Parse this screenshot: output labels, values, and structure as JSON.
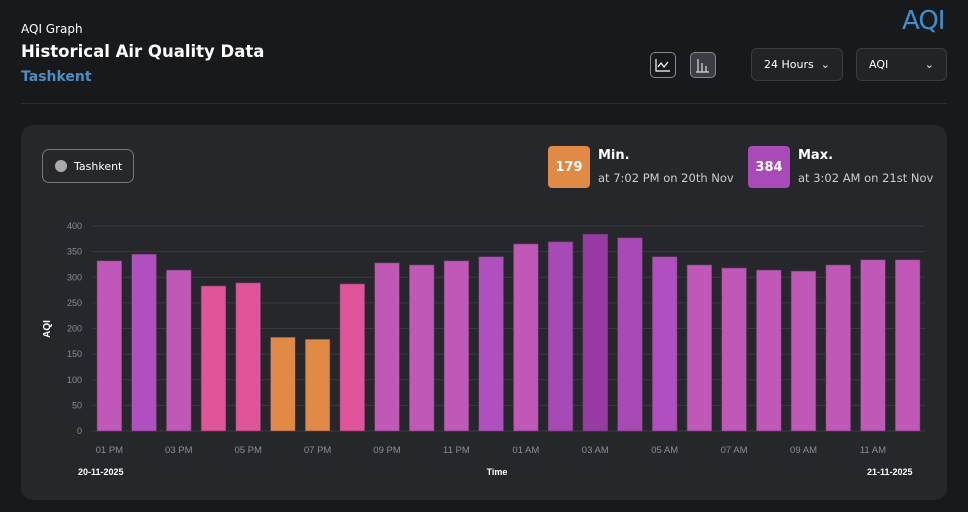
{
  "header": {
    "subtitle": "AQI Graph",
    "title": "Historical Air Quality Data",
    "city": "Tashkent",
    "logo": "AQI"
  },
  "toolbar": {
    "line_chart_icon": "line-chart-icon",
    "bar_chart_icon": "bar-chart-icon",
    "range": "24 Hours",
    "metric": "AQI"
  },
  "legend": {
    "label": "Tashkent"
  },
  "stats": {
    "min": {
      "value": "179",
      "label": "Min.",
      "detail": "at 7:02 PM on 20th Nov",
      "color": "#e08a45"
    },
    "max": {
      "value": "384",
      "label": "Max.",
      "detail": "at 3:02 AM on 21st Nov",
      "color": "#a84ab8"
    }
  },
  "chart_data": {
    "type": "bar",
    "ylabel": "AQI",
    "xlabel": "Time",
    "ylim": [
      0,
      400
    ],
    "yticks": [
      0,
      50,
      100,
      150,
      200,
      250,
      300,
      350,
      400
    ],
    "categories": [
      "01 PM",
      "02 PM",
      "03 PM",
      "04 PM",
      "05 PM",
      "06 PM",
      "07 PM",
      "08 PM",
      "09 PM",
      "10 PM",
      "11 PM",
      "12 AM",
      "01 AM",
      "02 AM",
      "03 AM",
      "04 AM",
      "05 AM",
      "06 AM",
      "07 AM",
      "08 AM",
      "09 AM",
      "10 AM",
      "11 AM",
      "12 PM"
    ],
    "xtick_labels": [
      "01 PM",
      "03 PM",
      "05 PM",
      "07 PM",
      "09 PM",
      "11 PM",
      "01 AM",
      "03 AM",
      "05 AM",
      "07 AM",
      "09 AM",
      "11 AM"
    ],
    "values": [
      332,
      345,
      314,
      283,
      289,
      183,
      179,
      287,
      328,
      324,
      332,
      340,
      365,
      369,
      384,
      377,
      340,
      324,
      318,
      314,
      312,
      324,
      334,
      334
    ],
    "colors": [
      "#c058b8",
      "#b050c0",
      "#c058b8",
      "#e0559a",
      "#e0559a",
      "#e08a45",
      "#e08a45",
      "#e0559a",
      "#c058b8",
      "#c058b8",
      "#c058b8",
      "#b050c0",
      "#c058b8",
      "#a84ab5",
      "#983aa3",
      "#a84ab5",
      "#b050c0",
      "#c058b8",
      "#c058b8",
      "#c058b8",
      "#c058b8",
      "#c058b8",
      "#c058b8",
      "#c058b8"
    ],
    "grid": true,
    "start_date": "20-11-2025",
    "end_date": "21-11-2025"
  }
}
